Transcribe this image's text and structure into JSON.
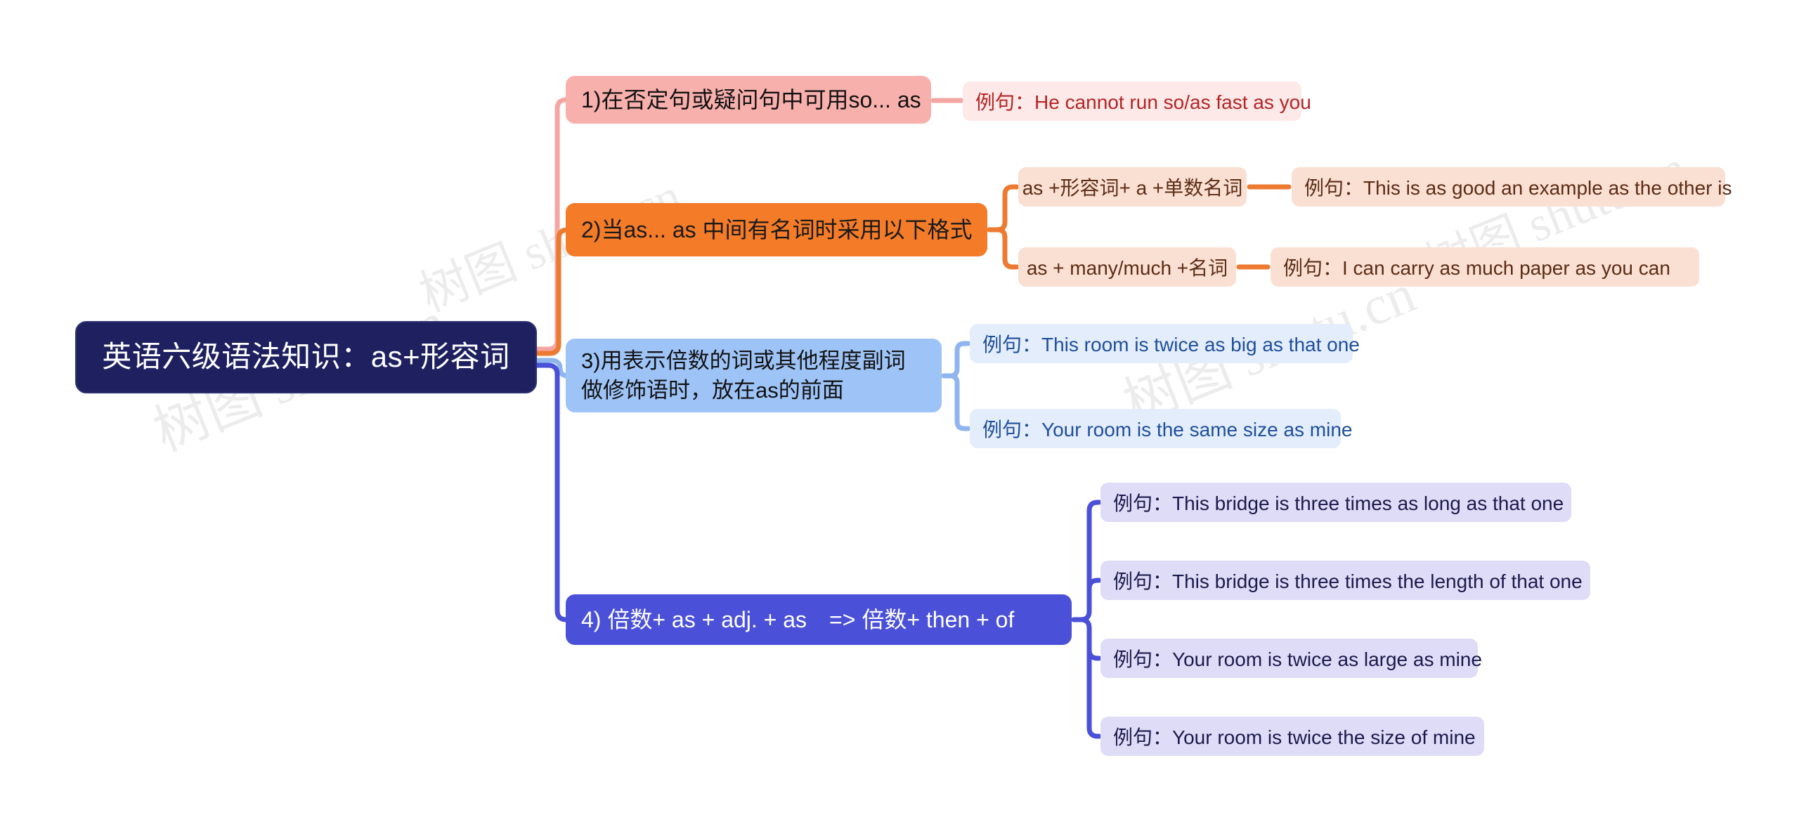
{
  "map": {
    "root": {
      "label": "英语六级语法知识：as+形容词",
      "bg": "#1e2060",
      "text_color": "#ffffff"
    },
    "branches": [
      {
        "id": "branch-1",
        "label": "1)在否定句或疑问句中可用so... as",
        "bg": "#f8b0ad",
        "connector_color": "#f4a6a2",
        "children": [
          {
            "id": "branch-1-example-1",
            "label": "例句：He cannot run so/as fast as you",
            "bg": "#fce9e8",
            "text_color": "#b52425"
          }
        ]
      },
      {
        "id": "branch-2",
        "label": "2)当as... as 中间有名词时采用以下格式",
        "bg": "#f47b28",
        "connector_color": "#ec7a31",
        "children": [
          {
            "id": "branch-2-format-1",
            "label": "as +形容词+ a +单数名词",
            "bg": "#fae0d2",
            "text_color": "#5c2c16",
            "example": {
              "id": "branch-2-example-1",
              "label": "例句：This is as good an example as the other is",
              "bg": "#fae0d2",
              "text_color": "#5c2c16"
            }
          },
          {
            "id": "branch-2-format-2",
            "label": "as + many/much +名词",
            "bg": "#fae0d2",
            "text_color": "#5c2c16",
            "example": {
              "id": "branch-2-example-2",
              "label": "例句：I can carry as much paper as you can",
              "bg": "#fae0d2",
              "text_color": "#5c2c16"
            }
          }
        ]
      },
      {
        "id": "branch-3",
        "label": "3)用表示倍数的词或其他程度副词做修饰语时，放在as的前面",
        "bg": "#9dc3f7",
        "connector_color": "#8fb5ef",
        "children": [
          {
            "id": "branch-3-example-1",
            "label": "例句：This room is twice as big as that one",
            "bg": "#e3edfb",
            "text_color": "#1f4f9c"
          },
          {
            "id": "branch-3-example-2",
            "label": "例句：Your room is the same size as mine",
            "bg": "#e3edfb",
            "text_color": "#1f4f9c"
          }
        ]
      },
      {
        "id": "branch-4",
        "label": "4) 倍数+ as + adj. + as　=> 倍数+ then + of",
        "bg": "#4a50d8",
        "connector_color": "#4a50d8",
        "text_color": "#ffffff",
        "children": [
          {
            "id": "branch-4-example-1",
            "label": "例句：This bridge is three times as long as that one",
            "bg": "#dedcf6",
            "text_color": "#1b1a4d"
          },
          {
            "id": "branch-4-example-2",
            "label": "例句：This bridge is three times the length of that one",
            "bg": "#dedcf6",
            "text_color": "#1b1a4d"
          },
          {
            "id": "branch-4-example-3",
            "label": "例句：Your room is twice as large as mine",
            "bg": "#dedcf6",
            "text_color": "#1b1a4d"
          },
          {
            "id": "branch-4-example-4",
            "label": "例句：Your room is twice the size of mine",
            "bg": "#dedcf6",
            "text_color": "#1b1a4d"
          }
        ]
      }
    ]
  },
  "watermarks": {
    "left_top": "树图 shutu.cn",
    "left_bottom": "树图 shutu.cn",
    "right_top": "树图 shutu.cn",
    "right_bottom": "树图 shutu.cn"
  }
}
